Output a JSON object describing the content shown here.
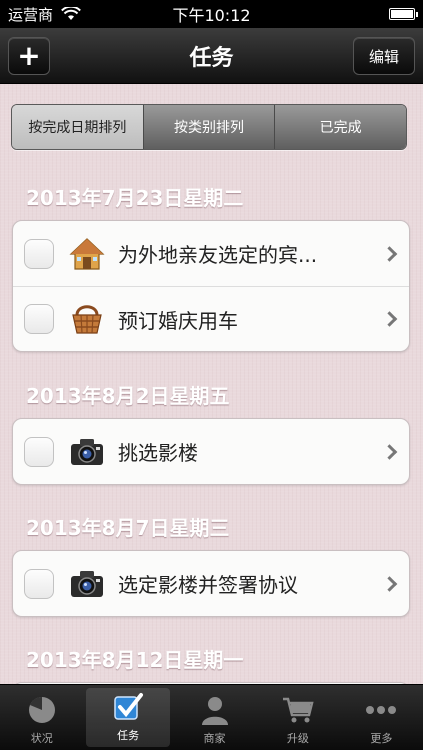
{
  "status_bar": {
    "carrier": "运营商",
    "time": "下午10:12"
  },
  "nav": {
    "title": "任务",
    "add_label": "+",
    "edit_label": "编辑"
  },
  "segments": [
    "按完成日期排列",
    "按类别排列",
    "已完成"
  ],
  "sections": [
    {
      "date": "2013年7月23日星期二",
      "items": [
        {
          "label": "为外地亲友选定的宾...",
          "icon": "house-icon"
        },
        {
          "label": "预订婚庆用车",
          "icon": "basket-icon"
        }
      ]
    },
    {
      "date": "2013年8月2日星期五",
      "items": [
        {
          "label": "挑选影楼",
          "icon": "camera-icon"
        }
      ]
    },
    {
      "date": "2013年8月7日星期三",
      "items": [
        {
          "label": "选定影楼并签署协议",
          "icon": "camera-icon"
        }
      ]
    },
    {
      "date": "2013年8月12日星期一",
      "items": []
    }
  ],
  "tabs": [
    {
      "label": "状况",
      "icon": "pie-chart-icon"
    },
    {
      "label": "任务",
      "icon": "checkbox-icon",
      "active": true
    },
    {
      "label": "商家",
      "icon": "person-icon"
    },
    {
      "label": "升级",
      "icon": "cart-icon"
    },
    {
      "label": "更多",
      "icon": "more-dots-icon"
    }
  ]
}
